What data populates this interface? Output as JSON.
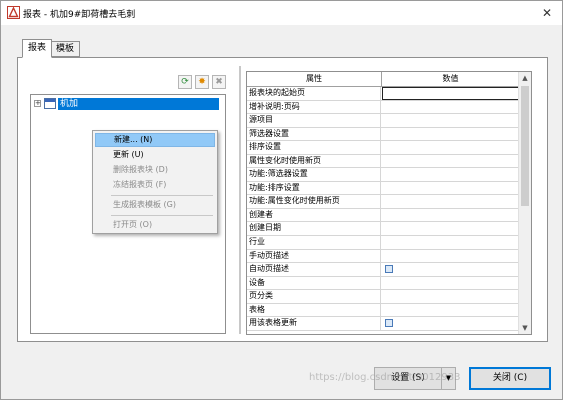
{
  "window": {
    "title": "报表 - 机加9#卸荷槽去毛刺",
    "close_symbol": "✕"
  },
  "tabs": [
    {
      "label": "报表",
      "active": true
    },
    {
      "label": "模板",
      "active": false
    }
  ],
  "toolbar": {
    "refresh_symbol": "⟳",
    "new_symbol": "✸",
    "delete_symbol": "✖"
  },
  "tree": {
    "expander_symbol": "+",
    "node_label": "机加"
  },
  "context_menu": {
    "items": [
      {
        "label": "新建... (N)",
        "enabled": true,
        "highlighted": true
      },
      {
        "label": "更新 (U)",
        "enabled": true
      },
      {
        "label": "删除报表块 (D)",
        "enabled": false
      },
      {
        "label": "冻结报表页 (F)",
        "enabled": false
      },
      {
        "label": "生成报表模板 (G)",
        "enabled": false
      },
      {
        "label": "打开页 (O)",
        "enabled": false
      }
    ]
  },
  "grid": {
    "headers": {
      "property": "属性",
      "value": "数值"
    },
    "rows": [
      {
        "name": "报表块的起始页",
        "checkbox": false,
        "selected": true
      },
      {
        "name": "增补说明:页码",
        "checkbox": false
      },
      {
        "name": "源项目",
        "checkbox": false
      },
      {
        "name": "筛选器设置",
        "checkbox": false
      },
      {
        "name": "排序设置",
        "checkbox": false
      },
      {
        "name": "属性变化时使用新页",
        "checkbox": false
      },
      {
        "name": "功能:筛选器设置",
        "checkbox": false
      },
      {
        "name": "功能:排序设置",
        "checkbox": false
      },
      {
        "name": "功能:属性变化时使用新页",
        "checkbox": false
      },
      {
        "name": "创建者",
        "checkbox": false
      },
      {
        "name": "创建日期",
        "checkbox": false
      },
      {
        "name": "行业",
        "checkbox": false
      },
      {
        "name": "手动页描述",
        "checkbox": false
      },
      {
        "name": "自动页描述",
        "checkbox": true
      },
      {
        "name": "设备",
        "checkbox": false
      },
      {
        "name": "页分类",
        "checkbox": false
      },
      {
        "name": "表格",
        "checkbox": false
      },
      {
        "name": "用该表格更新",
        "checkbox": true
      }
    ],
    "scroll_up": "▲",
    "scroll_down": "▼"
  },
  "buttons": {
    "settings_label": "设置 (S)",
    "settings_arrow": "▼",
    "close_label": "关闭 (C)"
  },
  "watermark": "https://blog.csdn.net/u012933"
}
